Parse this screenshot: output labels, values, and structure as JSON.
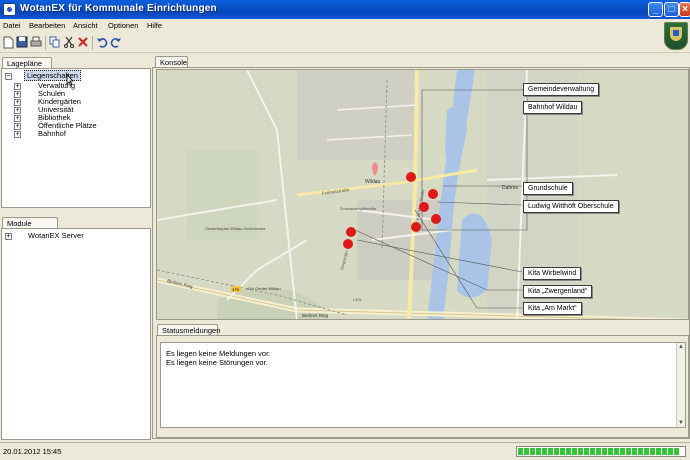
{
  "window": {
    "title": "WotanEX für Kommunale Einrichtungen"
  },
  "menu": [
    "Datei",
    "Bearbeiten",
    "Ansicht",
    "Optionen",
    "Hilfe"
  ],
  "toolbar": {
    "icons": [
      "new-icon",
      "save-icon",
      "print-icon",
      "copy-icon",
      "cut-icon",
      "delete-icon",
      "undo-icon",
      "redo-icon"
    ]
  },
  "lageplaene": {
    "tab": "Lagepläne",
    "root": "Liegenschaften",
    "items": [
      "Verwaltung",
      "Schulen",
      "Kindergärten",
      "Universität",
      "Bibliothek",
      "Öffentliche Plätze",
      "Bahnhof"
    ]
  },
  "module": {
    "tab": "Module",
    "items": [
      "WotanEX Server"
    ]
  },
  "konsole": {
    "tab": "Konsole"
  },
  "map": {
    "street_labels": [
      "Freiheitstraße",
      "Wildau",
      "Dahme",
      "Gewerbepark Wildau-Hoherlehme",
      "A10 Center Wildau",
      "Berliner Ring",
      "Berliner Ring",
      "Schwartzkopffstraße",
      "Karl-Marx-Straße",
      "Bergstraße",
      "L401",
      "179"
    ],
    "callouts": [
      "Gemeindeverwaltung",
      "Bahnhof Wildau",
      "Grundschule",
      "Ludwig Witthöft Oberschule",
      "Kita Wirbelwind",
      "Kita „Zwergenland“",
      "Kita „Am Markt“"
    ]
  },
  "statusmeldungen": {
    "tab": "Statusmeldungen",
    "lines": [
      "Es liegen keine Meldungen vor.",
      "Es liegen keine Störungen vor."
    ]
  },
  "statusbar": {
    "datetime": "20.01.2012 15:45",
    "progress_fraction": 0.97
  },
  "colors": {
    "titlebar": "#0a56d6",
    "marker": "#e01818",
    "water": "#a9c4e6",
    "progress": "#36c43a"
  }
}
